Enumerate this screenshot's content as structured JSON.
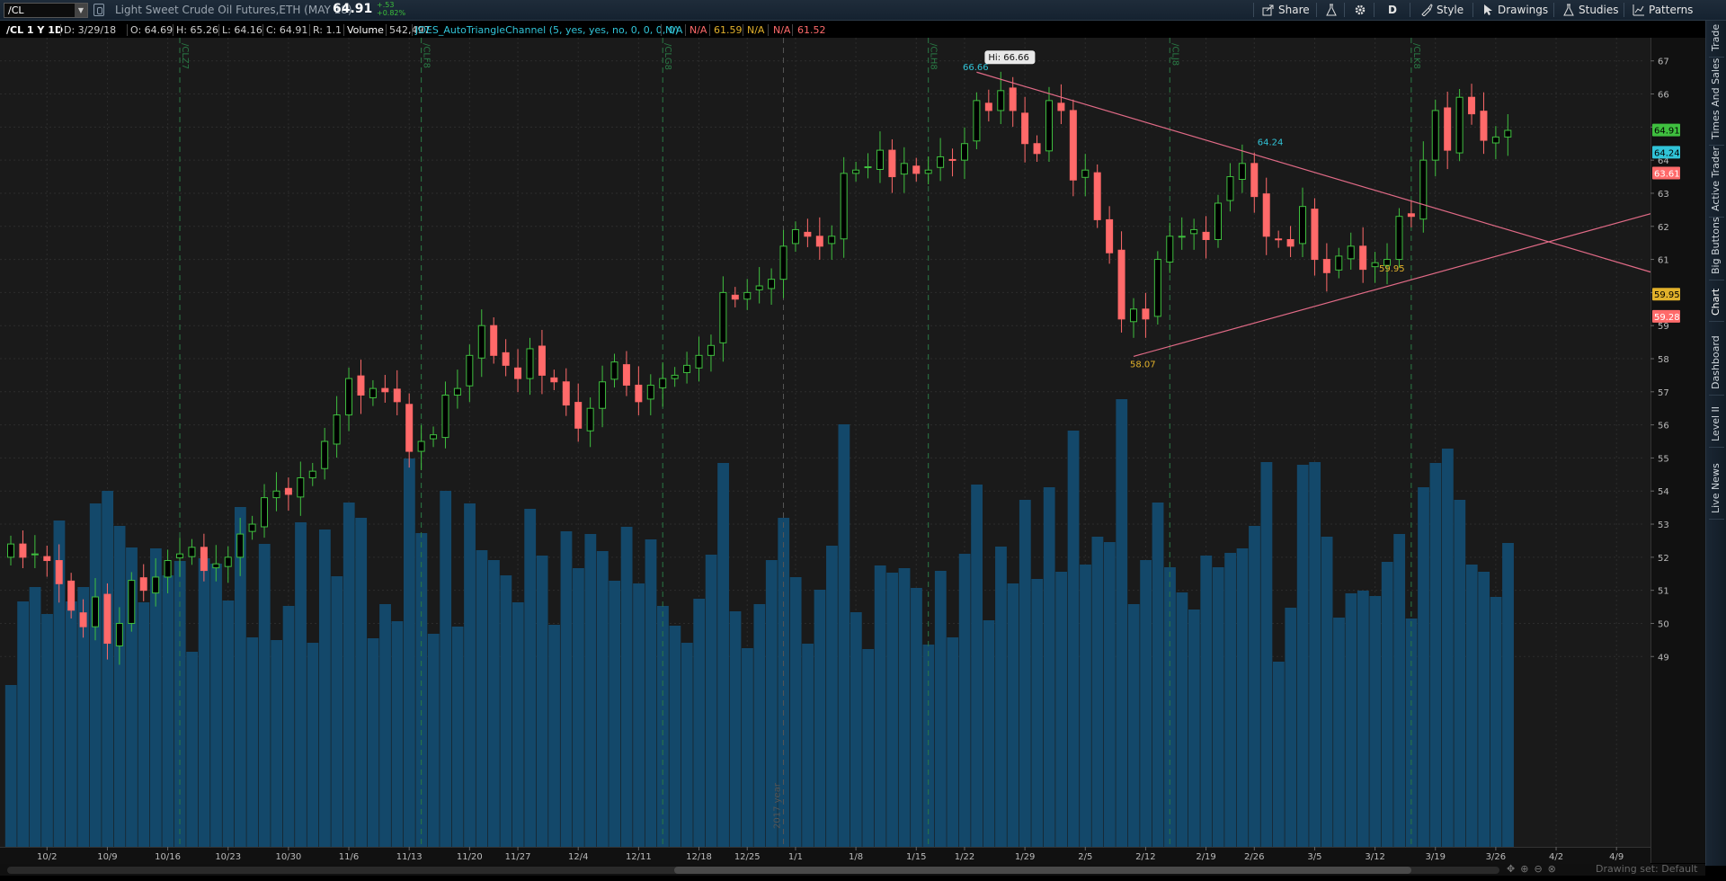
{
  "toolbar": {
    "symbol": "/CL",
    "description": "Light Sweet Crude Oil Futures,ETH (MAY 18)",
    "last_price": "64.91",
    "change_abs": "+.53",
    "change_pct": "+0.82%",
    "share_label": "Share",
    "period_label": "D",
    "style_label": "Style",
    "drawings_label": "Drawings",
    "studies_label": "Studies",
    "patterns_label": "Patterns"
  },
  "info": {
    "title": "/CL 1 Y 1D",
    "date": "D: 3/29/18",
    "open": "O: 64.69",
    "high": "H: 65.26",
    "low": "L: 64.16",
    "close": "C: 64.91",
    "range": "R: 1.1",
    "volume_label": "Volume",
    "volume_value": "542,497",
    "study_label": "JOES_AutoTriangleChannel (5, yes, yes, no, 0, 0, 0, 0)",
    "study_values": [
      "N/A",
      "N/A",
      "61.59",
      "N/A",
      "N/A",
      "61.52"
    ],
    "colors": {
      "up": "#3fbf3f",
      "down": "#ff6a6a",
      "volume": "#13486a",
      "trendline": "#e06a86",
      "study_cyan": "#31c4d8",
      "study_yellow": "#e2b12b"
    }
  },
  "side_tabs": [
    "Trade",
    "Times And Sales",
    "Active Trader",
    "Big Buttons",
    "Chart",
    "Dashboard",
    "Level II",
    "Live News"
  ],
  "bottom": {
    "drawing_set": "Drawing set: Default"
  },
  "chart_data": {
    "type": "candlestick",
    "ylim": [
      48.6,
      67.4
    ],
    "y_ticks": [
      "67",
      "66",
      "65",
      "64",
      "63",
      "62",
      "61",
      "60",
      "59",
      "58",
      "57",
      "56",
      "55",
      "54",
      "53",
      "52",
      "51",
      "50",
      "49"
    ],
    "x_ticks": [
      {
        "i": 3,
        "label": "10/2"
      },
      {
        "i": 8,
        "label": "10/9"
      },
      {
        "i": 13,
        "label": "10/16"
      },
      {
        "i": 18,
        "label": "10/23"
      },
      {
        "i": 23,
        "label": "10/30"
      },
      {
        "i": 28,
        "label": "11/6"
      },
      {
        "i": 33,
        "label": "11/13"
      },
      {
        "i": 38,
        "label": "11/20"
      },
      {
        "i": 42,
        "label": "11/27"
      },
      {
        "i": 47,
        "label": "12/4"
      },
      {
        "i": 52,
        "label": "12/11"
      },
      {
        "i": 57,
        "label": "12/18"
      },
      {
        "i": 61,
        "label": "12/25"
      },
      {
        "i": 65,
        "label": "1/1"
      },
      {
        "i": 70,
        "label": "1/8"
      },
      {
        "i": 75,
        "label": "1/15"
      },
      {
        "i": 79,
        "label": "1/22"
      },
      {
        "i": 84,
        "label": "1/29"
      },
      {
        "i": 89,
        "label": "2/5"
      },
      {
        "i": 94,
        "label": "2/12"
      },
      {
        "i": 99,
        "label": "2/19"
      },
      {
        "i": 103,
        "label": "2/26"
      },
      {
        "i": 108,
        "label": "3/5"
      },
      {
        "i": 113,
        "label": "3/12"
      },
      {
        "i": 118,
        "label": "3/19"
      },
      {
        "i": 123,
        "label": "3/26"
      },
      {
        "i": 128,
        "label": "4/2"
      },
      {
        "i": 133,
        "label": "4/9"
      }
    ],
    "expiry_markers": [
      {
        "i": 14,
        "label": "/CLZ7"
      },
      {
        "i": 34,
        "label": "/CLF8"
      },
      {
        "i": 54,
        "label": "/CLG8"
      },
      {
        "i": 76,
        "label": "/CLH8"
      },
      {
        "i": 96,
        "label": "/CLJ8"
      },
      {
        "i": 116,
        "label": "/CLK8"
      }
    ],
    "year_marker": {
      "i": 64,
      "label": "2017 year"
    },
    "annotations": [
      {
        "label": "Hi: 66.66"
      },
      {
        "label": "66.66"
      },
      {
        "label": "64.24"
      },
      {
        "label": "59.95"
      },
      {
        "label": "58.07"
      }
    ],
    "right_price_labels": [
      {
        "value": 64.91,
        "label": "64.91"
      },
      {
        "value": 64.24,
        "label": "64.24"
      },
      {
        "value": 63.61,
        "label": "63.61"
      },
      {
        "value": 59.95,
        "label": "59.95"
      },
      {
        "value": 59.28,
        "label": "59.28"
      }
    ],
    "trendlines": [
      {
        "from": {
          "i": 80,
          "price": 66.66
        },
        "to": {
          "i": 136,
          "price": 60.6
        }
      },
      {
        "from": {
          "i": 93,
          "price": 58.07
        },
        "to": {
          "i": 136,
          "price": 62.4
        }
      }
    ],
    "closes": [
      52.4,
      52.0,
      52.1,
      51.9,
      51.2,
      50.4,
      49.9,
      50.8,
      49.4,
      50.0,
      51.3,
      51.0,
      51.4,
      51.9,
      52.1,
      52.3,
      51.6,
      51.8,
      52.0,
      52.7,
      53.0,
      53.8,
      54.0,
      53.9,
      54.4,
      54.6,
      55.5,
      56.3,
      57.4,
      56.9,
      57.1,
      57.0,
      56.7,
      55.2,
      55.5,
      55.7,
      56.9,
      57.1,
      58.1,
      59.0,
      58.1,
      57.8,
      57.4,
      58.3,
      57.5,
      57.3,
      56.6,
      55.9,
      56.5,
      57.3,
      57.9,
      57.2,
      56.7,
      57.2,
      57.4,
      57.5,
      57.8,
      58.1,
      58.4,
      60.0,
      59.8,
      60.0,
      60.2,
      60.4,
      61.4,
      61.9,
      61.7,
      61.4,
      61.7,
      63.6,
      63.7,
      63.8,
      64.3,
      63.5,
      63.9,
      63.6,
      63.7,
      64.1,
      64.0,
      64.5,
      65.8,
      65.5,
      66.1,
      65.5,
      64.5,
      64.2,
      65.8,
      65.5,
      63.4,
      63.7,
      62.2,
      61.2,
      59.2,
      59.5,
      59.2,
      61.0,
      61.7,
      61.7,
      61.9,
      61.6,
      62.7,
      63.5,
      63.9,
      62.9,
      61.7,
      61.6,
      61.4,
      62.6,
      61.0,
      60.6,
      61.1,
      61.4,
      60.7,
      60.9,
      61.0,
      62.3,
      62.3,
      64.0,
      65.5,
      64.3,
      65.9,
      65.4,
      64.6,
      64.7,
      64.9
    ]
  }
}
